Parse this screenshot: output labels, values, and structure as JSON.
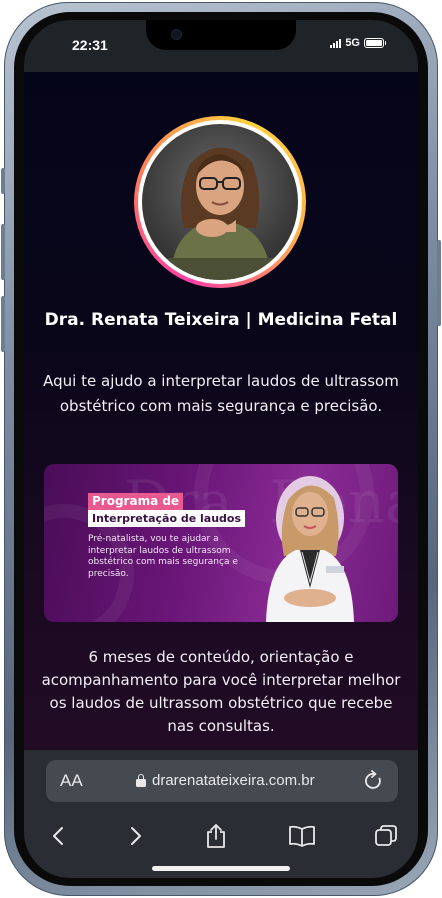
{
  "status_bar": {
    "time": "22:31",
    "network": "5G"
  },
  "profile": {
    "name": "Dra. Renata Teixeira | Medicina Fetal",
    "bio": "Aqui te ajudo a interpretar laudos de ultrassom obstétrico com mais segurança e precisão."
  },
  "banner": {
    "title_line1": "Programa de",
    "title_line2": "Interpretação de laudos",
    "text": "Pré-natalista, vou te ajudar a interpretar laudos de ultrassom obstétrico com mais segurança e precisão.",
    "watermark": "Dra. Renata Teixeira"
  },
  "description": "6 meses de conteúdo, orientação e acompanhamento para você interpretar melhor os laudos de ultrassom obstétrico que recebe nas consultas.",
  "browser": {
    "text_size_label": "AA",
    "url": "drarenatateixeira.com.br"
  },
  "colors": {
    "page_background": "#070616",
    "banner_accent": "#e7598f",
    "toolbar": "#2a2d33"
  },
  "icons": {
    "reload": "reload-icon",
    "back": "chevron-left-icon",
    "forward": "chevron-right-icon",
    "share": "share-icon",
    "bookmarks": "book-icon",
    "tabs": "tabs-icon",
    "lock": "lock-icon"
  }
}
